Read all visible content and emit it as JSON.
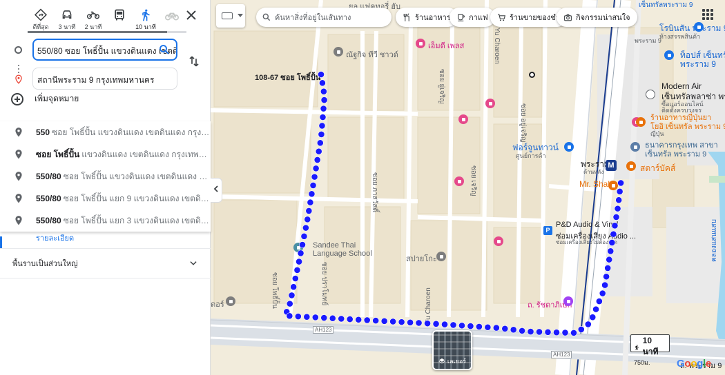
{
  "travel_modes": [
    {
      "name": "best",
      "label": "ดีที่สุด",
      "icon": "diamond-route-icon"
    },
    {
      "name": "driving",
      "label": "3 นาที",
      "icon": "car-icon"
    },
    {
      "name": "motorcycle",
      "label": "2 นาที",
      "icon": "motorcycle-icon"
    },
    {
      "name": "transit",
      "label": "",
      "icon": "bus-icon"
    },
    {
      "name": "walking",
      "label": "10 นาที",
      "icon": "walking-icon",
      "active": true
    },
    {
      "name": "cycling",
      "label": "",
      "icon": "bicycle-icon",
      "disabled": true
    }
  ],
  "origin": {
    "value": "550/80 ซอย โพธิ์ปั้น แขวงดินแดง เขตดิน"
  },
  "destination": {
    "value": "สถานีพระราม 9 กรุงเทพมหานคร"
  },
  "add_destination": "เพิ่มจุดหมาย",
  "suggestions": [
    {
      "main": "550",
      "secondary": "ซอย โพธิ์ปั้น แขวงดินแดง เขตดินแดง กรุงเทพมหาน..."
    },
    {
      "main": "ซอย โพธิ์ปั้น",
      "secondary": "แขวงดินแดง เขตดินแดง กรุงเทพมหานคร 1..."
    },
    {
      "main": "550/80",
      "secondary": "ซอย โพธิ์ปั้น แขวงดินแดง เขตดินแดง กรุงเทพม..."
    },
    {
      "main": "550/80",
      "secondary": "ซอย โพธิ์ปั้น แยก 9 แขวงดินแดง เขตดินแดง กรุ..."
    },
    {
      "main": "550/80",
      "secondary": "ซอย โพธิ์ปั้น แยก 3 แขวงดินแดง เขตดินแดง กรุ..."
    }
  ],
  "partial_link": "รายละเอียด",
  "section": {
    "label": "พื้นราบเป็นส่วนใหญ่"
  },
  "map": {
    "search_placeholder": "ค้นหาสิ่งที่อยู่ในเส้นทาง",
    "chips": [
      {
        "label": "ร้านอาหาร",
        "icon": "fork-knife-icon"
      },
      {
        "label": "กาแฟ",
        "icon": "coffee-cup-icon"
      },
      {
        "label": "ร้านขายของชำ",
        "icon": "cart-icon"
      },
      {
        "label": "กิจกรรมน่าสนใจ",
        "icon": "camera-icon"
      }
    ],
    "start_label": "108-67 ซอย โพธิ์ปั้น",
    "walk_time": "10 นาที",
    "walk_distance": "750ม.",
    "layer_label": "เลเยอร์",
    "labels": {
      "top_partial": "ยล แฟคทอรี่ ฮับ",
      "bunjit": "ณัฐกิจ ทีวี ชาวด์",
      "mdplace": "เอ็มดี เพลส",
      "modern_air": "Modern Air",
      "central_plaza": "เซ็นทรัลพลาซ่า พระราม 9",
      "central_plaza_sub": "ซื้อแอร์ออนไลน์",
      "central_plaza_sub2": "ติดตั้งครบวงจร",
      "robinson": "โรบินสัน พระราม 9",
      "robinson_sub": "ห้างสรรพสินค้า",
      "tops": "ท็อปส์ เซ็นทรัล",
      "tops2": "พระราม 9",
      "jp_rest": "ร้านอาหารญี่ปุ่นยา",
      "jp_rest2": "โยอิ เซ็นทรัล พระราม 9",
      "jp_rest3": "ญี่ปุ่น",
      "bank": "ธนาคารกรุงเทพ สาขา",
      "bank2": "เซ็นทรัล พระราม 9",
      "starbucks": "สตาร์บัคส์",
      "fortune": "ฟอร์จูนทาวน์",
      "fortune_sub": "ศูนย์การค้า",
      "rama9_station": "พระราม 9",
      "rama9_station_sub": "ด้านหลัง",
      "mrshake": "Mr. Shake",
      "pd_audio": "P&D Audio & Vinyl",
      "pd_audio2": "ซ่อมเครื่องเสียง Audio ...",
      "pd_audio3": "ซ่อมเครื่องเสียงไม่ต้องเปิด",
      "sandee": "Sandee Thai",
      "sandee2": "Language School",
      "sapaiyoko": "สปายโกะ",
      "ratchada": "ถ. รัชดาภิเษก",
      "rama9_road": "ถ. พระราม 9",
      "tor": "ตอร์",
      "topright_partial": "เซ็นทรัลพระราม 9",
      "top_right_small": "พระราม 9"
    },
    "roads": {
      "yu_charoen_top": "Yu Charoen",
      "yu_charoen_bottom": "Yu Charoen",
      "ah123_a": "AH123",
      "ah123_b": "AH123",
      "soi_1": "ซอย ยู่เจริญ",
      "soi_2": "ซอย อยู่เจริญ",
      "soi_3": "ซอย ภาสวัสดิ์",
      "soi_4": "ซอย ปราโมทย์",
      "soi_5": "ซอย โพธิ์ปั้น",
      "soi_6": "ซอย เจริญ",
      "canal": "คลองแสนแสบ"
    }
  },
  "colors": {
    "route": "#1a1aff",
    "accent": "#1a73e8",
    "destination_pin": "#ea4335"
  }
}
